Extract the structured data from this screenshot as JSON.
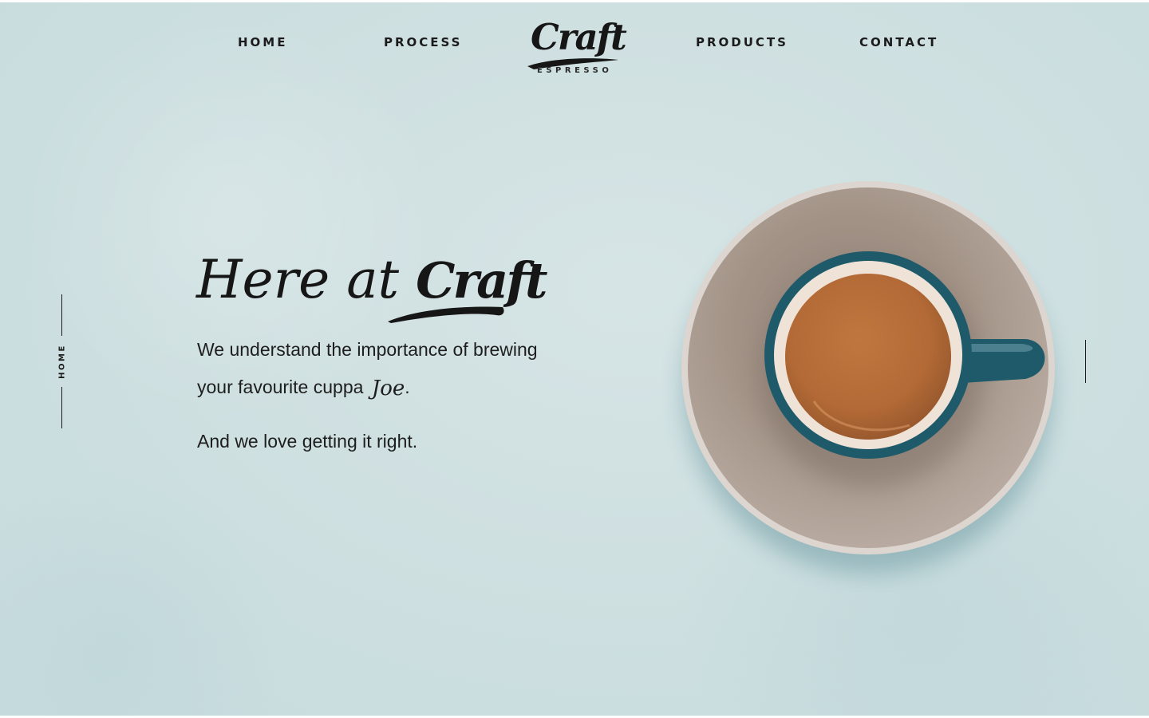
{
  "nav": {
    "home": "HOME",
    "process": "PROCESS",
    "products": "PRODUCTS",
    "contact": "CONTACT"
  },
  "logo": {
    "wordmark": "Craft",
    "subtitle": "ESPRESSO"
  },
  "side_indicator": {
    "label": "HOME"
  },
  "hero": {
    "heading_prefix": "Here at",
    "heading_brand": "Craft",
    "line1": "We understand the importance of brewing",
    "line2_prefix": "your favourite cuppa",
    "line2_script": "Joe",
    "line2_suffix": ".",
    "line3": "And we love getting it right."
  },
  "colors": {
    "background": "#cfe0e1",
    "text": "#1b1b1b",
    "cup_teal": "#1f5a6a",
    "coffee": "#b8703f",
    "saucer": "#a8978c"
  },
  "icons": {
    "coffee_image": "coffee-cup-on-saucer"
  }
}
